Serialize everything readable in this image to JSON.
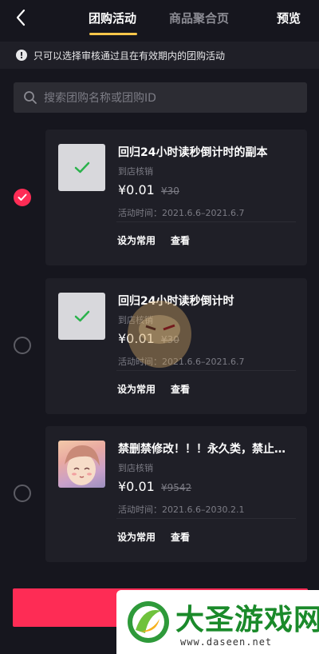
{
  "header": {
    "tabs": [
      {
        "label": "团购活动",
        "active": true
      },
      {
        "label": "商品聚合页",
        "active": false
      }
    ],
    "preview_label": "预览"
  },
  "notice": {
    "text": "只可以选择审核通过且在有效期内的团购活动"
  },
  "search": {
    "placeholder": "搜索团购名称或团购ID"
  },
  "items": [
    {
      "title": "回归24小时读秒倒计时的副本",
      "tag": "到店核销",
      "price": "¥0.01",
      "original_price": "¥30",
      "time": "活动时间：2021.6.6–2021.6.7",
      "set_common_label": "设为常用",
      "view_label": "查看",
      "selected": true,
      "thumb_checked": true
    },
    {
      "title": "回归24小时读秒倒计时",
      "tag": "到店核销",
      "price": "¥0.01",
      "original_price": "¥30",
      "time": "活动时间：2021.6.6–2021.6.7",
      "set_common_label": "设为常用",
      "view_label": "查看",
      "selected": false,
      "thumb_checked": true
    },
    {
      "title": "禁删禁修改！！！永久类，禁止…",
      "tag": "到店核销",
      "price": "¥0.01",
      "original_price": "¥9542",
      "time": "活动时间：2021.6.6–2030.2.1",
      "set_common_label": "设为常用",
      "view_label": "查看",
      "selected": false,
      "thumb_checked": false
    }
  ],
  "watermark": {
    "brand": "大圣游戏网",
    "url": "www.daseen.net"
  },
  "colors": {
    "accent": "#fe2c55",
    "tab_underline": "#f7c64a",
    "background": "#16161e",
    "card": "#1f1f27"
  }
}
